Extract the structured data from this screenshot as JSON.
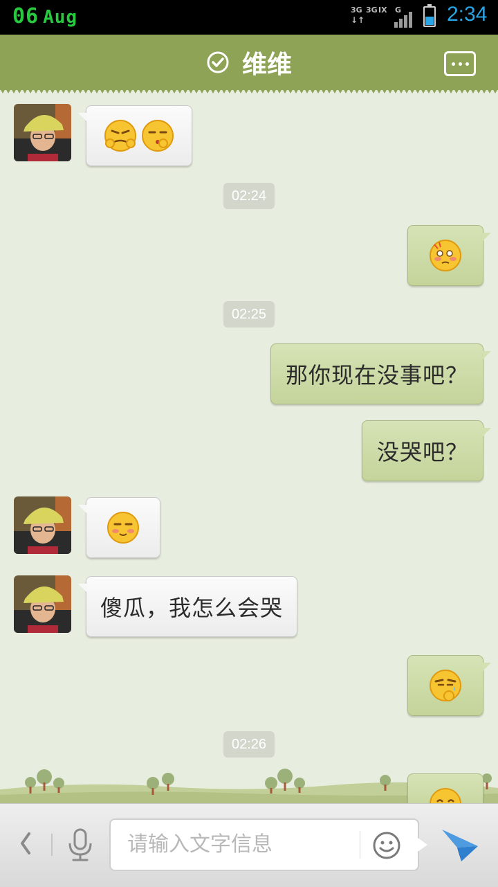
{
  "status_bar": {
    "date_day": "06",
    "date_month": "Aug",
    "time": "2:34",
    "network_labels": [
      "3G",
      "3G",
      "IX",
      "G"
    ],
    "battery_level": 0.45
  },
  "header": {
    "title": "维维",
    "verified_icon": "check-circle-icon",
    "more_icon": "more-dots-icon"
  },
  "messages": {
    "m3_text": "那你现在没事吧？",
    "m4_text": "没哭吧？",
    "m6_text": "傻瓜，我怎么会哭"
  },
  "timestamps": [
    "02:24",
    "02:25",
    "02:26"
  ],
  "input": {
    "placeholder": "请输入文字信息",
    "back_icon": "chevron-left-icon",
    "mic_icon": "microphone-icon",
    "emoji_icon": "smiley-icon",
    "send_icon": "paper-plane-icon"
  },
  "colors": {
    "header": "#8ea356",
    "background": "#e8eedf",
    "out_bubble": "#c8d79f",
    "in_bubble": "#f5f5f5",
    "accent_blue": "#2aa5e5",
    "status_date": "#27c93f"
  }
}
